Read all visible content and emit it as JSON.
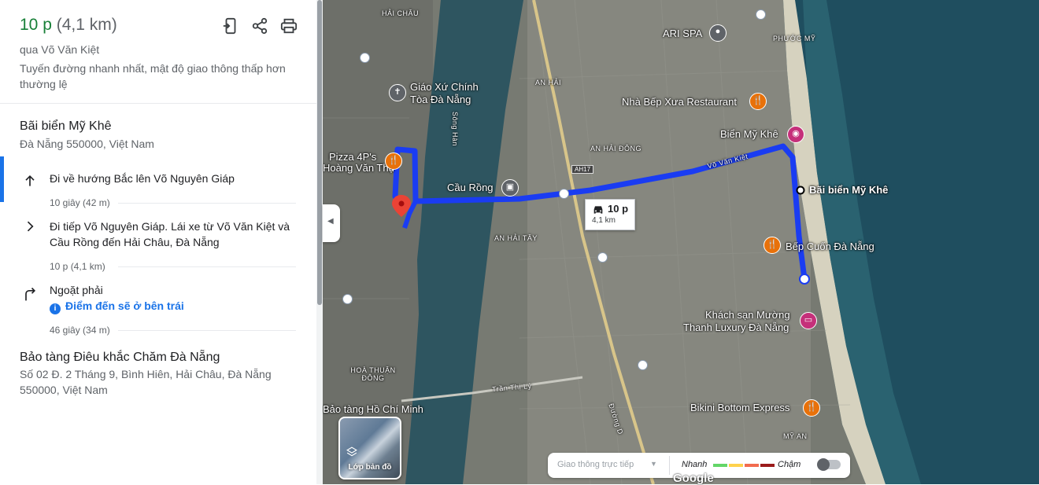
{
  "summary": {
    "time": "10 p",
    "distance": "(4,1 km)",
    "via": "qua Võ Văn Kiệt",
    "description": "Tuyến đường nhanh nhất, mật độ giao thông thấp hơn thường lệ"
  },
  "header_icons": [
    "send-to-phone-icon",
    "share-icon",
    "print-icon"
  ],
  "start": {
    "name": "Bãi biển Mỹ Khê",
    "address": "Đà Nẵng 550000, Việt Nam"
  },
  "steps": [
    {
      "icon": "arrow-up-icon",
      "text": "Đi về hướng Bắc lên Võ Nguyên Giáp",
      "meta": "10 giây (42 m)"
    },
    {
      "icon": "chevron-right-icon",
      "text": "Đi tiếp Võ Nguyên Giáp. Lái xe từ Võ Văn Kiệt và Cầu Rồng đến Hải Châu, Đà Nẵng",
      "meta": "10 p (4,1 km)"
    },
    {
      "icon": "turn-right-icon",
      "text": "Ngoặt phải",
      "note": "Điểm đến sẽ ở bên trái",
      "meta": "46 giây (34 m)"
    }
  ],
  "destination": {
    "name": "Bảo tàng Điêu khắc Chăm Đà Nẵng",
    "address": "Số 02 Đ. 2 Tháng 9, Bình Hiên, Hải Châu, Đà Nẵng 550000, Việt Nam"
  },
  "map": {
    "route_label": {
      "time": "10 p",
      "distance": "4,1 km"
    },
    "labels": {
      "hai_chau": "HẢI CHÂU",
      "phuoc_my": "PHƯỚC MỸ",
      "an_hai": "AN HẢI",
      "an_hai_dong": "AN HẢI ĐÔNG",
      "an_hai_tay": "AN HẢI TÂY",
      "hoa_thuan_dong": "HOÀ THUẬN ĐÔNG",
      "my_an": "MỸ AN",
      "song_han": "Sông Hàn",
      "vo_van_kiet": "Võ Văn Kiệt",
      "tran_thi_ly": "Trần Thị Lý",
      "duong_d": "Đường D",
      "ah17": "AH17"
    },
    "pois": {
      "ari_spa": "ARI SPA",
      "nha_bep_xua": "Nhà Bếp Xưa Restaurant",
      "giao_xu": "Giáo Xứ Chính Tòa Đà Nẵng",
      "pizza": "Pizza 4P's",
      "pizza2": "Hoàng Văn Thụ",
      "cau_rong": "Cầu Rồng",
      "bien_my_khe": "Biển Mỹ Khê",
      "bai_bien": "Bãi biển Mỹ Khê",
      "bep_cuon": "Bếp Cuốn Đà Nẵng",
      "khach_san": "Khách sạn Mường",
      "khach_san2": "Thanh Luxury Đà Nẵng",
      "bikini": "Bikini Bottom Express",
      "bao_tang_hcm": "Bảo tàng Hồ Chí Minh"
    },
    "layer_button": "Lớp bản đồ",
    "traffic": {
      "selector": "Giao thông trực tiếp",
      "fast": "Nhanh",
      "slow": "Chậm",
      "colors": [
        "#63d668",
        "#ffd24d",
        "#f26c4f",
        "#9b1c1c"
      ]
    },
    "attribution": "Google",
    "colors": {
      "route": "#1a3cf2",
      "sea": "#1f4e5f",
      "river": "#2e5560"
    }
  }
}
